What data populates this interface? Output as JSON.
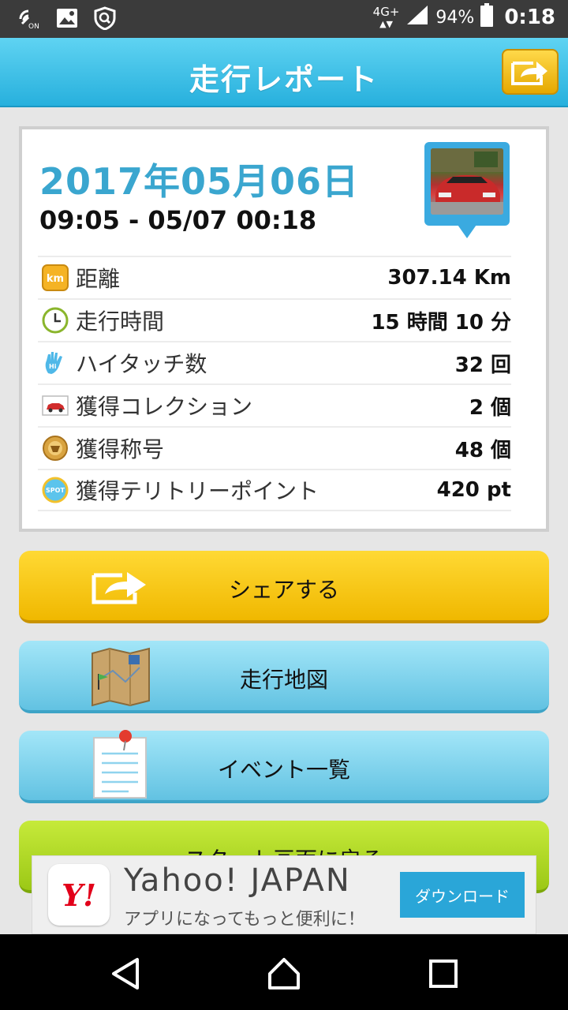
{
  "statusbar": {
    "network": "4G+",
    "battery": "94%",
    "time": "0:18"
  },
  "header": {
    "title": "走行レポート"
  },
  "report": {
    "date": "2017年05月06日",
    "time_range": "09:05 - 05/07 00:18",
    "stats": [
      {
        "icon": "km-icon",
        "label": "距離",
        "value": "307.14 Km"
      },
      {
        "icon": "clock-icon",
        "label": "走行時間",
        "value": "15 時間 10 分"
      },
      {
        "icon": "hi-five-icon",
        "label": "ハイタッチ数",
        "value": "32 回"
      },
      {
        "icon": "car-collection-icon",
        "label": "獲得コレクション",
        "value": "2 個"
      },
      {
        "icon": "medal-icon",
        "label": "獲得称号",
        "value": "48 個"
      },
      {
        "icon": "spot-icon",
        "label": "獲得テリトリーポイント",
        "value": "420 pt"
      }
    ]
  },
  "buttons": {
    "share": "シェアする",
    "map": "走行地図",
    "events": "イベント一覧",
    "start": "スタート画面に戻る"
  },
  "ad": {
    "logo": "Y!",
    "title": "Yahoo! JAPAN",
    "subtitle": "アプリになってもっと便利に！",
    "cta": "ダウンロード"
  },
  "colors": {
    "header": "#27b0dd",
    "date": "#3aa6cf",
    "share_button": "#f0b800",
    "blue_button": "#62c2e2",
    "start_button": "#9cc816"
  }
}
